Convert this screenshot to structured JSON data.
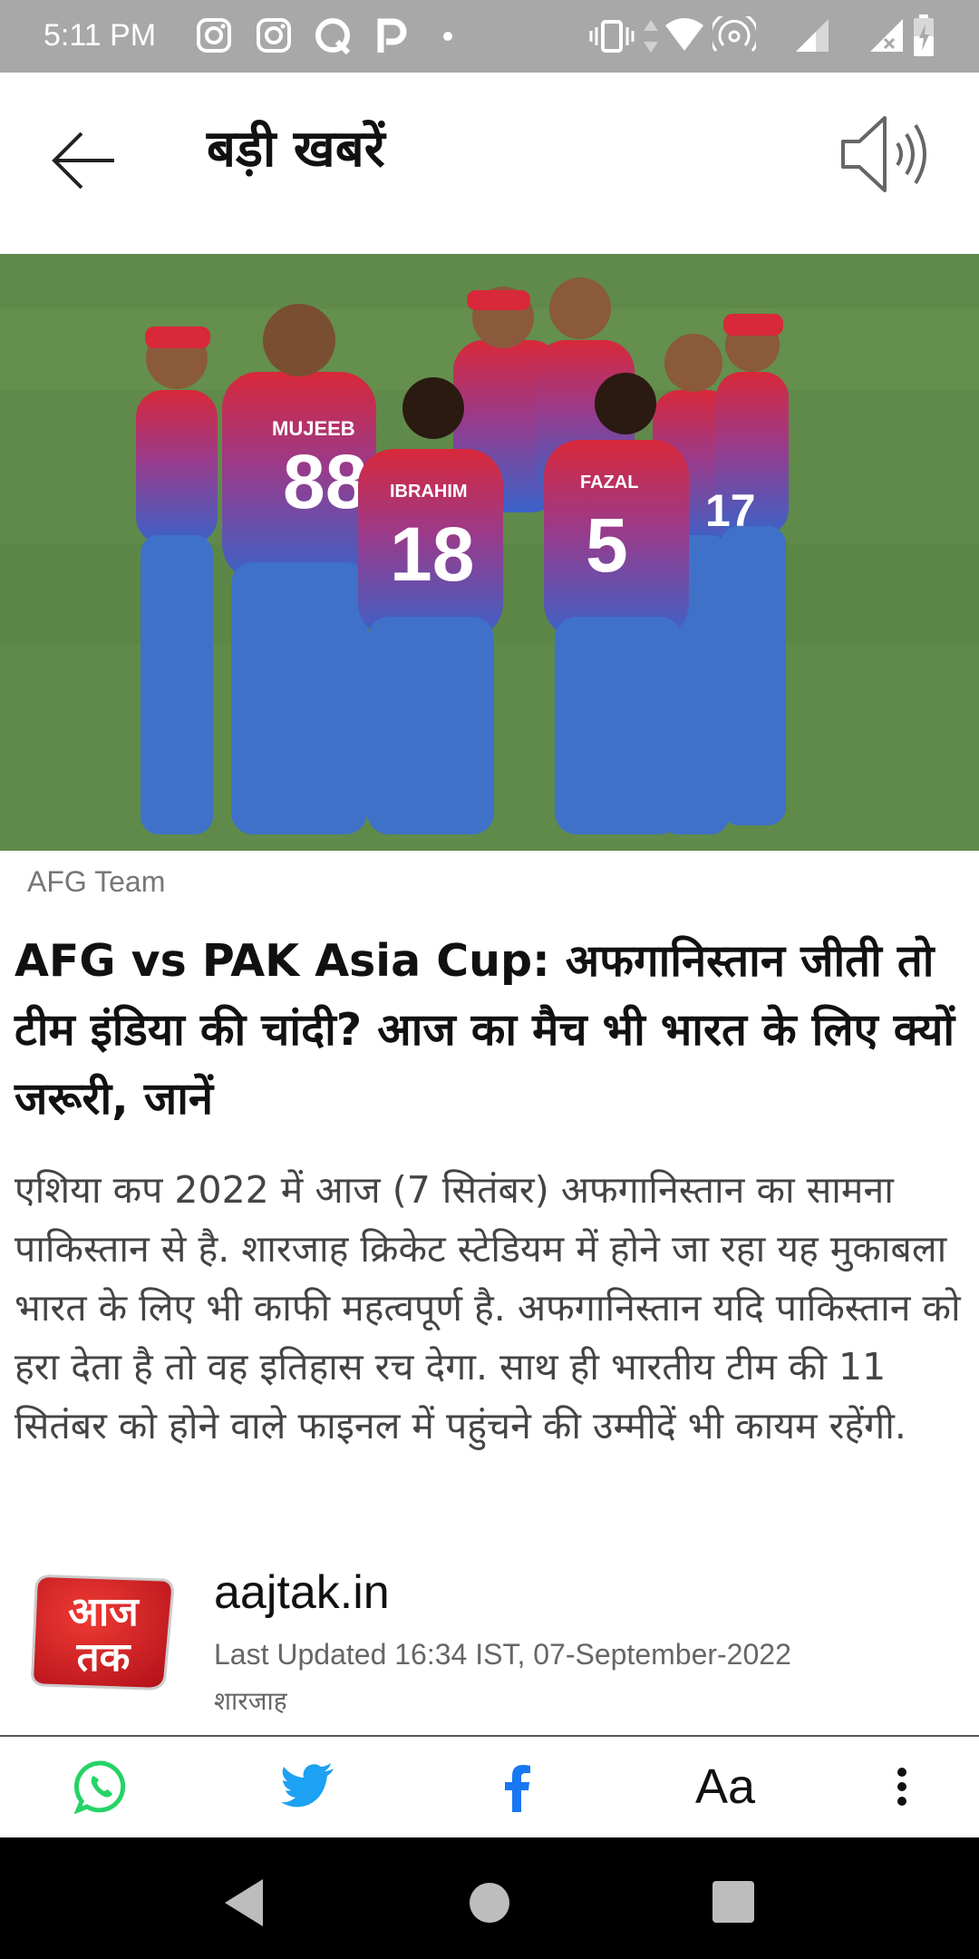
{
  "status_bar": {
    "time": "5:11 PM",
    "icons": [
      "instagram-icon",
      "instagram-icon",
      "quora-icon",
      "paytm-icon",
      "dot-icon",
      "vibrate-icon",
      "data-arrows-icon",
      "wifi-icon",
      "hotspot-icon",
      "signal-icon",
      "signal-x-icon",
      "battery-charging-icon"
    ]
  },
  "app_bar": {
    "title": "बड़ी खबरें",
    "back_icon": "arrow-left-icon",
    "audio_icon": "speaker-icon"
  },
  "article": {
    "image_caption": "AFG Team",
    "headline": "AFG vs PAK Asia Cup: अफगानिस्तान जीती तो टीम इंडिया की चांदी? आज का मैच भी भारत के लिए क्यों जरूरी, जानें",
    "summary": "एशिया कप 2022 में आज (7 सितंबर) अफगानिस्तान का सामना पाकिस्तान से है. शारजाह क्रिकेट स्टेडियम में होने जा रहा यह मुकाबला भारत के लिए भी काफी महत्वपूर्ण है. अफगानिस्तान यदि पाकिस्तान को हरा देता है तो वह इतिहास रच देगा. साथ ही भारतीय टीम की 11 सितंबर को होने वाले फाइनल में पहुंचने की उम्मीदें भी कायम रहेंगी.",
    "source": {
      "logo_text_top": "आज",
      "logo_text_bottom": "तक",
      "name": "aajtak.in",
      "updated": "Last Updated 16:34 IST, 07-September-2022",
      "location": "शारजाह"
    },
    "players": [
      {
        "name": "MUJEEB",
        "number": "88"
      },
      {
        "name": "IBRAHIM",
        "number": "18"
      },
      {
        "name": "FAZAL",
        "number": "5"
      },
      {
        "name": "",
        "number": "17"
      }
    ]
  },
  "share_bar": {
    "font_label": "Aa",
    "icons": [
      "whatsapp-icon",
      "twitter-icon",
      "facebook-icon",
      "more-vert-icon"
    ]
  },
  "colors": {
    "status_bar": "#a8a8a8",
    "jersey_red": "#d8283a",
    "jersey_blue": "#3a63c9",
    "whatsapp": "#25d366",
    "twitter": "#1da1f2",
    "facebook": "#1877f2",
    "logo_red": "#d71920"
  }
}
